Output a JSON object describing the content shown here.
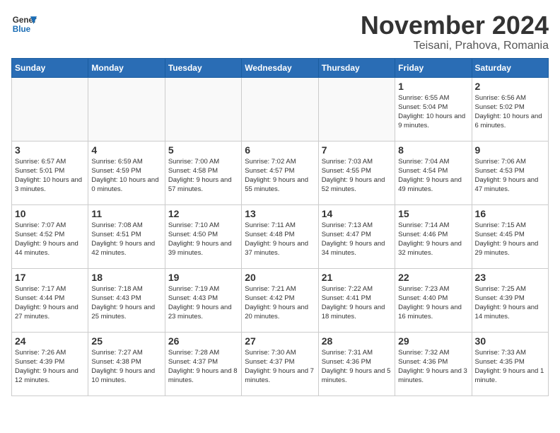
{
  "header": {
    "logo_line1": "General",
    "logo_line2": "Blue",
    "month_title": "November 2024",
    "location": "Teisani, Prahova, Romania"
  },
  "weekdays": [
    "Sunday",
    "Monday",
    "Tuesday",
    "Wednesday",
    "Thursday",
    "Friday",
    "Saturday"
  ],
  "weeks": [
    [
      {
        "day": "",
        "info": ""
      },
      {
        "day": "",
        "info": ""
      },
      {
        "day": "",
        "info": ""
      },
      {
        "day": "",
        "info": ""
      },
      {
        "day": "",
        "info": ""
      },
      {
        "day": "1",
        "info": "Sunrise: 6:55 AM\nSunset: 5:04 PM\nDaylight: 10 hours and 9 minutes."
      },
      {
        "day": "2",
        "info": "Sunrise: 6:56 AM\nSunset: 5:02 PM\nDaylight: 10 hours and 6 minutes."
      }
    ],
    [
      {
        "day": "3",
        "info": "Sunrise: 6:57 AM\nSunset: 5:01 PM\nDaylight: 10 hours and 3 minutes."
      },
      {
        "day": "4",
        "info": "Sunrise: 6:59 AM\nSunset: 4:59 PM\nDaylight: 10 hours and 0 minutes."
      },
      {
        "day": "5",
        "info": "Sunrise: 7:00 AM\nSunset: 4:58 PM\nDaylight: 9 hours and 57 minutes."
      },
      {
        "day": "6",
        "info": "Sunrise: 7:02 AM\nSunset: 4:57 PM\nDaylight: 9 hours and 55 minutes."
      },
      {
        "day": "7",
        "info": "Sunrise: 7:03 AM\nSunset: 4:55 PM\nDaylight: 9 hours and 52 minutes."
      },
      {
        "day": "8",
        "info": "Sunrise: 7:04 AM\nSunset: 4:54 PM\nDaylight: 9 hours and 49 minutes."
      },
      {
        "day": "9",
        "info": "Sunrise: 7:06 AM\nSunset: 4:53 PM\nDaylight: 9 hours and 47 minutes."
      }
    ],
    [
      {
        "day": "10",
        "info": "Sunrise: 7:07 AM\nSunset: 4:52 PM\nDaylight: 9 hours and 44 minutes."
      },
      {
        "day": "11",
        "info": "Sunrise: 7:08 AM\nSunset: 4:51 PM\nDaylight: 9 hours and 42 minutes."
      },
      {
        "day": "12",
        "info": "Sunrise: 7:10 AM\nSunset: 4:50 PM\nDaylight: 9 hours and 39 minutes."
      },
      {
        "day": "13",
        "info": "Sunrise: 7:11 AM\nSunset: 4:48 PM\nDaylight: 9 hours and 37 minutes."
      },
      {
        "day": "14",
        "info": "Sunrise: 7:13 AM\nSunset: 4:47 PM\nDaylight: 9 hours and 34 minutes."
      },
      {
        "day": "15",
        "info": "Sunrise: 7:14 AM\nSunset: 4:46 PM\nDaylight: 9 hours and 32 minutes."
      },
      {
        "day": "16",
        "info": "Sunrise: 7:15 AM\nSunset: 4:45 PM\nDaylight: 9 hours and 29 minutes."
      }
    ],
    [
      {
        "day": "17",
        "info": "Sunrise: 7:17 AM\nSunset: 4:44 PM\nDaylight: 9 hours and 27 minutes."
      },
      {
        "day": "18",
        "info": "Sunrise: 7:18 AM\nSunset: 4:43 PM\nDaylight: 9 hours and 25 minutes."
      },
      {
        "day": "19",
        "info": "Sunrise: 7:19 AM\nSunset: 4:43 PM\nDaylight: 9 hours and 23 minutes."
      },
      {
        "day": "20",
        "info": "Sunrise: 7:21 AM\nSunset: 4:42 PM\nDaylight: 9 hours and 20 minutes."
      },
      {
        "day": "21",
        "info": "Sunrise: 7:22 AM\nSunset: 4:41 PM\nDaylight: 9 hours and 18 minutes."
      },
      {
        "day": "22",
        "info": "Sunrise: 7:23 AM\nSunset: 4:40 PM\nDaylight: 9 hours and 16 minutes."
      },
      {
        "day": "23",
        "info": "Sunrise: 7:25 AM\nSunset: 4:39 PM\nDaylight: 9 hours and 14 minutes."
      }
    ],
    [
      {
        "day": "24",
        "info": "Sunrise: 7:26 AM\nSunset: 4:39 PM\nDaylight: 9 hours and 12 minutes."
      },
      {
        "day": "25",
        "info": "Sunrise: 7:27 AM\nSunset: 4:38 PM\nDaylight: 9 hours and 10 minutes."
      },
      {
        "day": "26",
        "info": "Sunrise: 7:28 AM\nSunset: 4:37 PM\nDaylight: 9 hours and 8 minutes."
      },
      {
        "day": "27",
        "info": "Sunrise: 7:30 AM\nSunset: 4:37 PM\nDaylight: 9 hours and 7 minutes."
      },
      {
        "day": "28",
        "info": "Sunrise: 7:31 AM\nSunset: 4:36 PM\nDaylight: 9 hours and 5 minutes."
      },
      {
        "day": "29",
        "info": "Sunrise: 7:32 AM\nSunset: 4:36 PM\nDaylight: 9 hours and 3 minutes."
      },
      {
        "day": "30",
        "info": "Sunrise: 7:33 AM\nSunset: 4:35 PM\nDaylight: 9 hours and 1 minute."
      }
    ]
  ]
}
